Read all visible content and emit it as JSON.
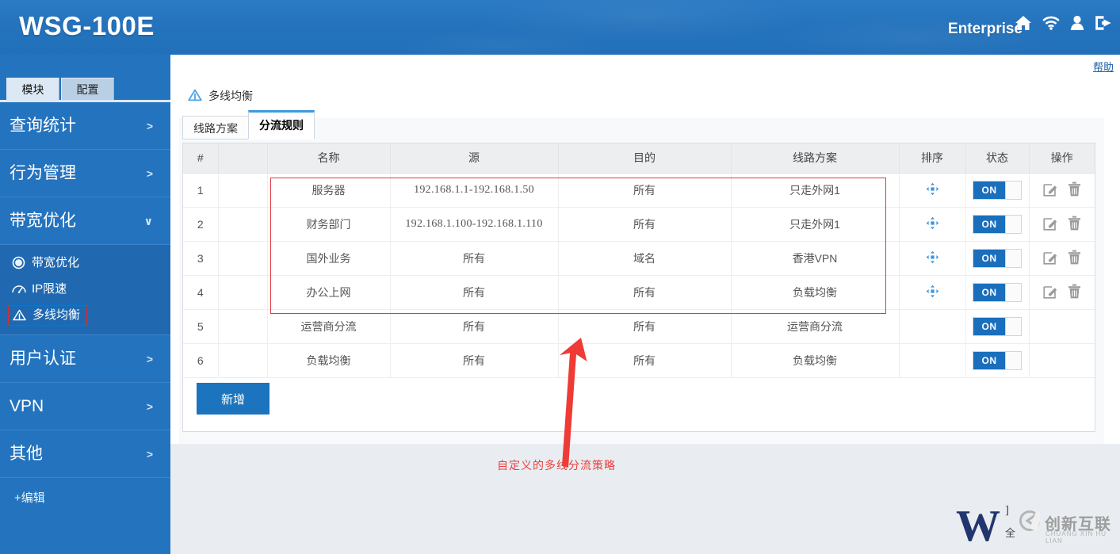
{
  "header": {
    "brand": "WSG-100E",
    "account_label": "Enterprise",
    "icons": [
      "home-icon",
      "wifi-icon",
      "user-icon",
      "logout-icon"
    ]
  },
  "sidebar": {
    "tabs": [
      {
        "label": "模块",
        "active": true
      },
      {
        "label": "配置",
        "active": false
      }
    ],
    "items": [
      {
        "label": "查询统计",
        "chevron": ">",
        "expanded": false
      },
      {
        "label": "行为管理",
        "chevron": ">",
        "expanded": false
      },
      {
        "label": "带宽优化",
        "chevron": "∨",
        "expanded": true
      }
    ],
    "sub_items": [
      {
        "label": "带宽优化",
        "icon": "bandwidth-icon",
        "selected": false
      },
      {
        "label": "IP限速",
        "icon": "speed-gauge-icon",
        "selected": false
      },
      {
        "label": "多线均衡",
        "icon": "multiline-icon",
        "selected": true
      }
    ],
    "items_after": [
      {
        "label": "用户认证",
        "chevron": ">"
      },
      {
        "label": "VPN",
        "chevron": ">"
      },
      {
        "label": "其他",
        "chevron": ">"
      }
    ],
    "edit_link": "+编辑",
    "collapse_handle": "collapse-sidebar"
  },
  "content": {
    "help_label": "帮助",
    "page_title": "多线均衡",
    "page_title_icon": "multiline-icon",
    "tabs": [
      {
        "label": "线路方案",
        "active": false
      },
      {
        "label": "分流规则",
        "active": true
      }
    ],
    "add_button": "新增",
    "table": {
      "columns": [
        "#",
        "",
        "名称",
        "源",
        "目的",
        "线路方案",
        "排序",
        "状态",
        "操作"
      ],
      "rows": [
        {
          "num": "1",
          "name": "服务器",
          "src": "192.168.1.1-192.168.1.50",
          "dst": "所有",
          "line": "只走外网1",
          "sort": "drag-handle-icon",
          "status": "ON",
          "actions": [
            "edit-icon",
            "delete-icon"
          ]
        },
        {
          "num": "2",
          "name": "财务部门",
          "src": "192.168.1.100-192.168.1.110",
          "dst": "所有",
          "line": "只走外网1",
          "sort": "drag-handle-icon",
          "status": "ON",
          "actions": [
            "edit-icon",
            "delete-icon"
          ]
        },
        {
          "num": "3",
          "name": "国外业务",
          "src": "所有",
          "dst": "域名",
          "line": "香港VPN",
          "sort": "drag-handle-icon",
          "status": "ON",
          "actions": [
            "edit-icon",
            "delete-icon"
          ]
        },
        {
          "num": "4",
          "name": "办公上网",
          "src": "所有",
          "dst": "所有",
          "line": "负载均衡",
          "sort": "drag-handle-icon",
          "status": "ON",
          "actions": [
            "edit-icon",
            "delete-icon"
          ]
        },
        {
          "num": "5",
          "name": "运营商分流",
          "src": "所有",
          "dst": "所有",
          "line": "运营商分流",
          "sort": "",
          "status": "ON",
          "actions": []
        },
        {
          "num": "6",
          "name": "负载均衡",
          "src": "所有",
          "dst": "所有",
          "line": "负载均衡",
          "sort": "",
          "status": "ON",
          "actions": []
        }
      ]
    }
  },
  "annotation": {
    "caption": "自定义的多线分流策略",
    "color": "#e8403f",
    "arrow": "callout-arrow"
  },
  "watermark": {
    "letter": "W",
    "bracket": "]",
    "sub": "全",
    "brand": "创新互联",
    "brand_pinyin": "CHUANG XIN HU LIAN"
  },
  "colors": {
    "header_blue": "#2473be",
    "sidebar_blue": "#2473be",
    "sub_blue": "#2069b1",
    "toggle_on": "#1a6fbd",
    "accent_tab": "#3e9ae0",
    "highlight_red": "#e0393f"
  }
}
